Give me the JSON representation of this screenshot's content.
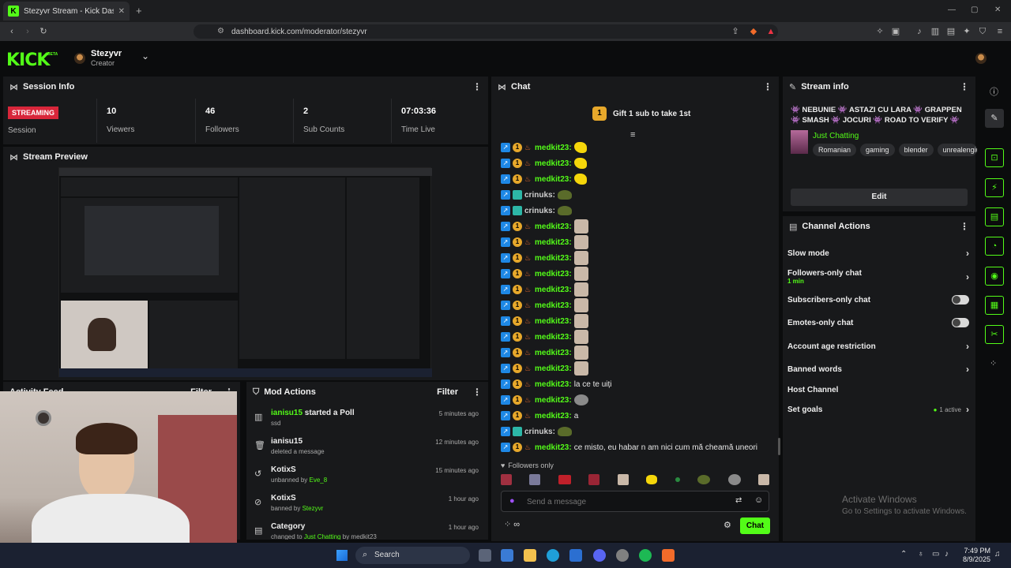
{
  "browser": {
    "tab_title": "Stezyvr Stream - Kick Dashboard",
    "url": "dashboard.kick.com/moderator/stezyvr",
    "new_tab": "+",
    "win_controls": [
      "—",
      "▢",
      "✕"
    ]
  },
  "header": {
    "logo": "KICK",
    "logo_badge": "BETA",
    "user": "Stezyvr",
    "role": "Creator"
  },
  "session_info": {
    "title": "Session Info",
    "badge": "STREAMING",
    "session_label": "Session",
    "stats": [
      {
        "value": "10",
        "label": "Viewers"
      },
      {
        "value": "46",
        "label": "Followers"
      },
      {
        "value": "2",
        "label": "Sub Counts"
      },
      {
        "value": "07:03:36",
        "label": "Time Live"
      }
    ]
  },
  "stream_preview": {
    "title": "Stream Preview"
  },
  "activity_feed": {
    "title": "Activity Feed",
    "filter": "Filter"
  },
  "mod_actions": {
    "title": "Mod Actions",
    "filter": "Filter",
    "rows": [
      {
        "name": "ianisu15",
        "action": " started a Poll",
        "detail": "ssd",
        "time": "5 minutes ago",
        "icon": "poll-icon"
      },
      {
        "name": "ianisu15",
        "action": "",
        "detail": "deleted a message",
        "time": "12 minutes ago",
        "icon": "trash-icon"
      },
      {
        "name": "KotixS",
        "action": "",
        "detail": "unbanned by ",
        "detail_user": "Eve_8",
        "time": "15 minutes ago",
        "icon": "unban-icon"
      },
      {
        "name": "KotixS",
        "action": "",
        "detail": "banned by ",
        "detail_user": "Stezyvr",
        "time": "1 hour ago",
        "icon": "ban-icon"
      },
      {
        "name": "Category",
        "action": "",
        "detail": "changed to ",
        "detail_user": "Just Chatting",
        "detail_tail": " by medkit23",
        "time": "1 hour ago",
        "icon": "category-icon"
      }
    ]
  },
  "chat": {
    "title": "Chat",
    "gift_text": "Gift 1 sub to take 1st",
    "gift_rank": "1",
    "messages": [
      {
        "user": "medkit23:",
        "text": "",
        "emote": "y",
        "badges": "one"
      },
      {
        "user": "medkit23:",
        "text": "",
        "emote": "y",
        "badges": "one"
      },
      {
        "user": "medkit23:",
        "text": "",
        "emote": "y",
        "badges": "one"
      },
      {
        "user": "crinuks:",
        "text": "",
        "emote": "g",
        "badges": "crin"
      },
      {
        "user": "crinuks:",
        "text": "",
        "emote": "g",
        "badges": "crin"
      },
      {
        "user": "medkit23:",
        "text": "",
        "emote": "p",
        "badges": "one"
      },
      {
        "user": "medkit23:",
        "text": "",
        "emote": "p",
        "badges": "one"
      },
      {
        "user": "medkit23:",
        "text": "",
        "emote": "p",
        "badges": "one"
      },
      {
        "user": "medkit23:",
        "text": "",
        "emote": "p",
        "badges": "one"
      },
      {
        "user": "medkit23:",
        "text": "",
        "emote": "p",
        "badges": "one"
      },
      {
        "user": "medkit23:",
        "text": "",
        "emote": "p",
        "badges": "one"
      },
      {
        "user": "medkit23:",
        "text": "",
        "emote": "p",
        "badges": "one"
      },
      {
        "user": "medkit23:",
        "text": "",
        "emote": "p",
        "badges": "one"
      },
      {
        "user": "medkit23:",
        "text": "",
        "emote": "p",
        "badges": "one"
      },
      {
        "user": "medkit23:",
        "text": "",
        "emote": "p",
        "badges": "one"
      },
      {
        "user": "medkit23:",
        "text": "la ce te uiți",
        "emote": "",
        "badges": "one"
      },
      {
        "user": "medkit23:",
        "text": "",
        "emote": "s",
        "badges": "one"
      },
      {
        "user": "medkit23:",
        "text": "a",
        "emote": "",
        "badges": "one"
      },
      {
        "user": "crinuks:",
        "text": "",
        "emote": "g",
        "badges": "crin"
      },
      {
        "user": "medkit23:",
        "text": "ce misto, eu habar n am nici cum mă cheamă uneori",
        "emote": "",
        "badges": "one"
      }
    ],
    "followers_only": "Followers only",
    "input_placeholder": "Send a message",
    "send_label": "Chat"
  },
  "stream_info": {
    "title": "Stream info",
    "stream_title": "👾 NEBUNIE 👾 ASTAZI CU LARA 👾 GRAPPEN 👾 SMASH 👾 JOCURI 👾 ROAD TO VERIFY 👾",
    "category": "Just Chatting",
    "tags": [
      "Romanian",
      "gaming",
      "blender",
      "unrealengine"
    ],
    "edit_label": "Edit"
  },
  "channel_actions": {
    "title": "Channel Actions",
    "slow_mode": "Slow mode",
    "followers_only": "Followers-only chat",
    "followers_only_value": "1 min",
    "subscribers_only": "Subscribers-only chat",
    "emotes_only": "Emotes-only chat",
    "account_age": "Account age restriction",
    "banned_words": "Banned words",
    "host_channel": "Host Channel",
    "set_goals": "Set goals",
    "goals_status": "1 active"
  },
  "watermark": {
    "line1": "Activate Windows",
    "line2": "Go to Settings to activate Windows."
  },
  "taskbar": {
    "search": "Search",
    "time": "7:49 PM",
    "date": "8/9/2025"
  },
  "colors": {
    "accent": "#53fc18",
    "streaming": "#d8263a",
    "panel": "#18191b"
  }
}
